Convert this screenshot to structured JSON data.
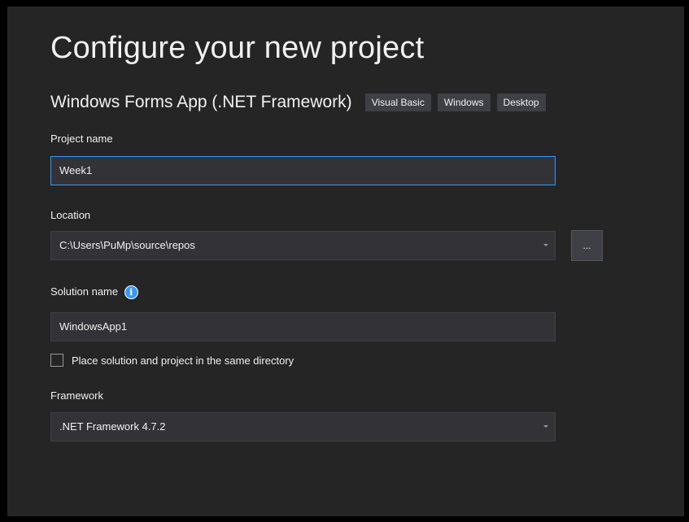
{
  "title": "Configure your new project",
  "template": {
    "name": "Windows Forms App (.NET Framework)",
    "tags": [
      "Visual Basic",
      "Windows",
      "Desktop"
    ]
  },
  "project_name": {
    "label": "Project name",
    "value": "Week1"
  },
  "location": {
    "label": "Location",
    "value": "C:\\Users\\PuMp\\source\\repos",
    "browse_label": "..."
  },
  "solution_name": {
    "label": "Solution name",
    "value": "WindowsApp1",
    "info_icon": "i"
  },
  "same_directory": {
    "label": "Place solution and project in the same directory",
    "checked": false
  },
  "framework": {
    "label": "Framework",
    "value": ".NET Framework 4.7.2"
  },
  "colors": {
    "background": "#252526",
    "field": "#333337",
    "focus_border": "#3399ff",
    "tag": "#3f3f46",
    "text": "#f1f1f1",
    "info_icon": "#3399ff"
  }
}
